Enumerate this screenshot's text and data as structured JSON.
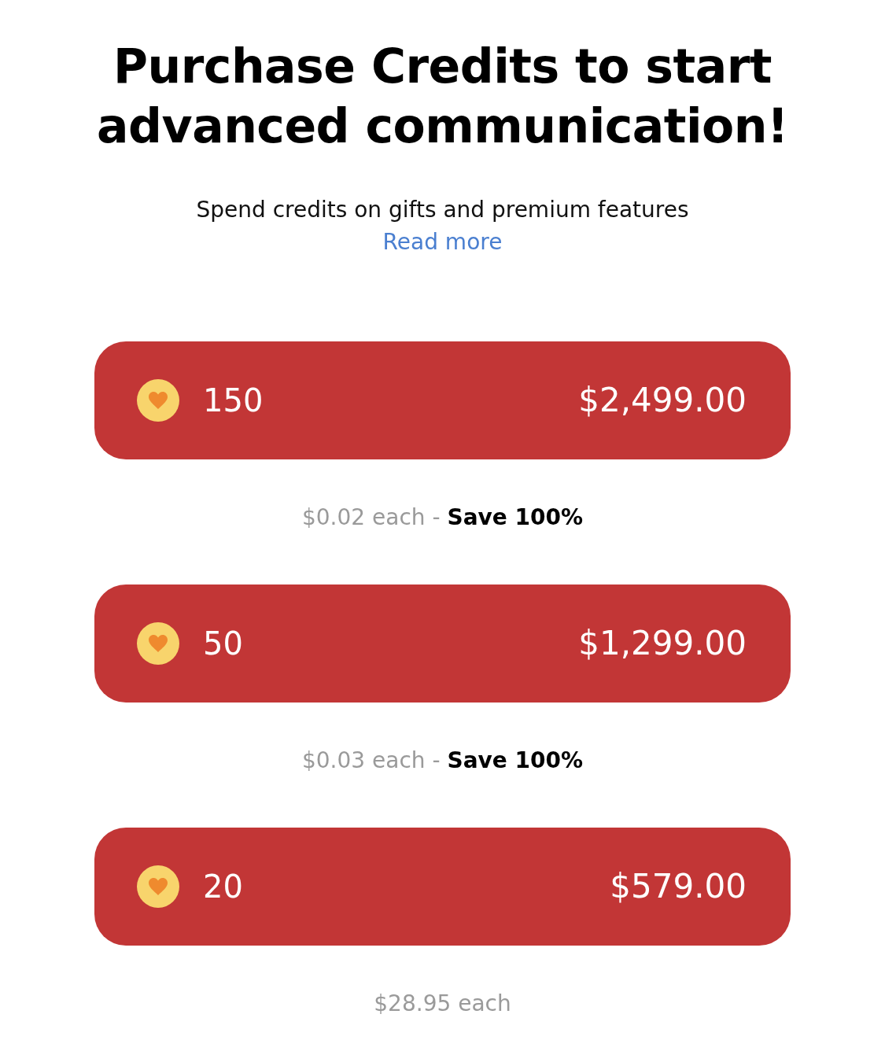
{
  "title": "Purchase Credits to start advanced communication!",
  "subtitle": "Spend credits on gifts and premium features",
  "link": "Read more",
  "packages": [
    {
      "credits": "150",
      "price": "$2,499.00",
      "caption": "$0.02 each - **Save 100%**"
    },
    {
      "credits": "50",
      "price": "$1,299.00",
      "caption": "$0.03 each - **Save 100%**"
    },
    {
      "credits": "20",
      "price": "$579.00",
      "caption": "$28.95 each"
    }
  ]
}
